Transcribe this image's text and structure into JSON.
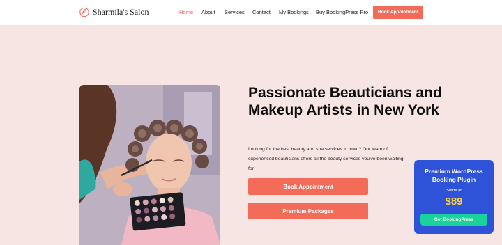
{
  "brand": {
    "name": "Sharmila's Salon",
    "logo_icon": "salon-leaf-logo",
    "accent": "#f36c5a"
  },
  "nav": {
    "items": [
      {
        "label": "Home",
        "active": true
      },
      {
        "label": "About",
        "active": false
      },
      {
        "label": "Services",
        "active": false
      },
      {
        "label": "Contact",
        "active": false
      },
      {
        "label": "My Bookings",
        "active": false
      },
      {
        "label": "Buy BookingPress Pro",
        "active": false
      }
    ],
    "cta_label": "Book Appointment"
  },
  "hero": {
    "title": "Passionate Beauticians and Makeup Artists in New York",
    "description": "Looking for the best beauty and spa services in town? Our team of experienced beauticians offers all the beauty services you've been waiting for.",
    "buttons": [
      "Book Appointment",
      "Premium Packages"
    ],
    "background": "#f7e5e3"
  },
  "promo": {
    "title": "Premium WordPress Booking Plugin",
    "starts_at": "Starts at",
    "price": "$89",
    "button_label": "Get BookingPress",
    "background": "#2e53d8",
    "price_color": "#ffd32a",
    "button_color": "#19d39b"
  }
}
